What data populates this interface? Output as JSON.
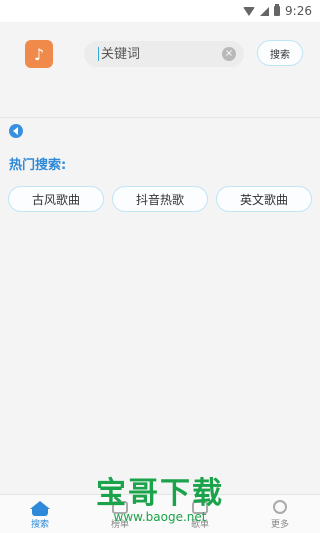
{
  "status_bar": {
    "time": "9:26",
    "icons": [
      "wifi-icon",
      "signal-icon",
      "battery-icon"
    ]
  },
  "search": {
    "placeholder": "关键词",
    "button_label": "搜索",
    "clear_icon": "×"
  },
  "app": {
    "logo_glyph": "♪",
    "logo_color": "#f08a4b"
  },
  "hot": {
    "label": "热门搜索:",
    "chips": [
      "古风歌曲",
      "抖音热歌",
      "英文歌曲"
    ]
  },
  "tabs": [
    {
      "label": "搜索",
      "icon": "home-icon",
      "active": true
    },
    {
      "label": "榜单",
      "icon": "list-icon",
      "active": false
    },
    {
      "label": "歌单",
      "icon": "playlist-icon",
      "active": false
    },
    {
      "label": "更多",
      "icon": "more-icon",
      "active": false
    }
  ],
  "watermark": {
    "brand": "宝哥下载",
    "url": "www.baoge.net"
  },
  "colors": {
    "accent": "#2e8ad8",
    "chip_border": "#bfe5f5",
    "watermark": "#1aa34a"
  }
}
